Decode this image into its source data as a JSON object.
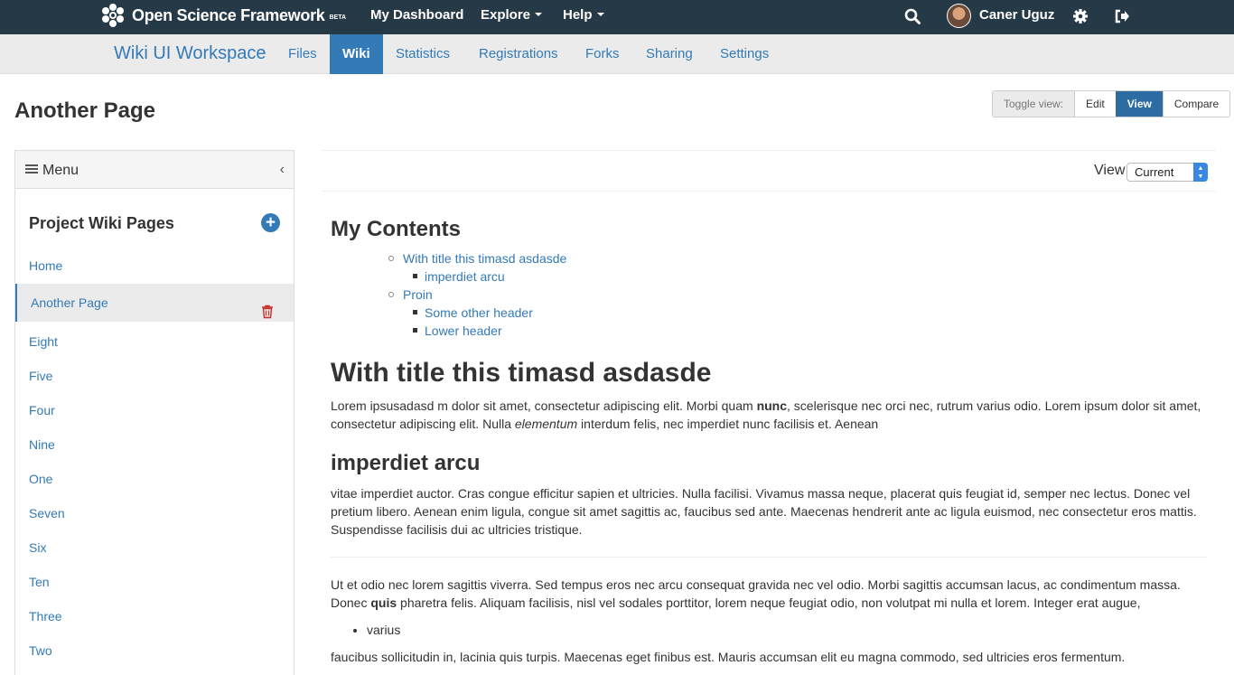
{
  "topnav": {
    "brand": "Open Science Framework",
    "beta": "BETA",
    "dashboard": "My Dashboard",
    "explore": "Explore",
    "help": "Help",
    "user": "Caner Uguz"
  },
  "project": {
    "title": "Wiki UI Workspace",
    "tabs": [
      "Files",
      "Wiki",
      "Statistics",
      "Registrations",
      "Forks",
      "Sharing",
      "Settings"
    ],
    "active_tab": "Wiki"
  },
  "page": {
    "title": "Another Page",
    "toggle_label": "Toggle view:",
    "toggle_edit": "Edit",
    "toggle_view": "View",
    "toggle_compare": "Compare",
    "view_label": "View",
    "view_selected": "Current"
  },
  "sidebar": {
    "menu_label": "Menu",
    "title": "Project Wiki Pages",
    "pages": [
      "Home",
      "Another Page",
      "Eight",
      "Five",
      "Four",
      "Nine",
      "One",
      "Seven",
      "Six",
      "Ten",
      "Three",
      "Two"
    ],
    "active_page": "Another Page"
  },
  "content": {
    "toc_title": "My Contents",
    "toc": {
      "item1": "With title this timasd asdasde",
      "item1_sub1": "imperdiet arcu",
      "item2": "Proin",
      "item2_sub1": "Some other header",
      "item2_sub2": "Lower header"
    },
    "h1": "With title this timasd asdasde",
    "p1_a": "Lorem ipsusadasd m dolor sit amet, consectetur adipiscing elit. Morbi quam ",
    "p1_b": "nunc",
    "p1_c": ", scelerisque nec orci nec, rutrum varius odio. Lorem ipsum dolor sit amet, consectetur adipiscing elit. Nulla ",
    "p1_d": "elementum",
    "p1_e": " interdum felis, nec imperdiet nunc facilisis et. Aenean",
    "h3": "imperdiet arcu",
    "p2": "vitae imperdiet auctor. Cras congue efficitur sapien et ultricies. Nulla facilisi. Vivamus massa neque, placerat quis feugiat id, semper nec lectus. Donec vel pretium libero. Aenean enim ligula, congue sit amet sagittis ac, faucibus sed ante. Maecenas hendrerit ante ac ligula euismod, nec consectetur eros mattis. Suspendisse facilisis dui ac ultricies tristique.",
    "p3_a": "Ut et odio nec lorem sagittis viverra. Sed tempus eros nec arcu consequat gravida nec vel odio. Morbi sagittis accumsan lacus, ac condimentum massa. Donec ",
    "p3_b": "quis",
    "p3_c": " pharetra felis. Aliquam facilisis, nisl vel sodales porttitor, lorem neque feugiat odio, non volutpat mi nulla et lorem. Integer erat augue,",
    "bullet": "varius",
    "p4": "faucibus sollicitudin in, lacinia quis turpis. Maecenas eget finibus est. Mauris accumsan elit eu magna commodo, sed ultricies eros fermentum."
  }
}
